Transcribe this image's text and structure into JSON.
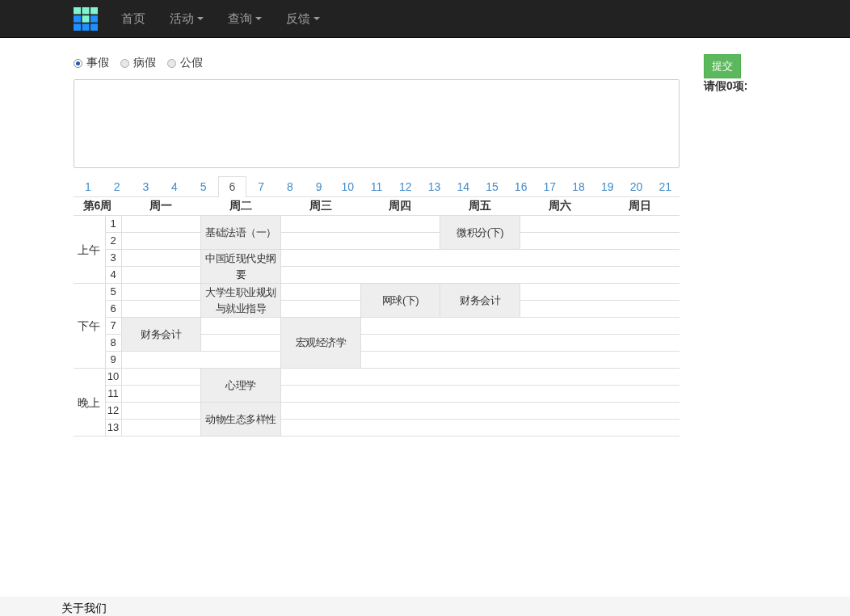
{
  "navbar": {
    "items": [
      {
        "label": "首页",
        "dropdown": false
      },
      {
        "label": "活动",
        "dropdown": true
      },
      {
        "label": "查询",
        "dropdown": true
      },
      {
        "label": "反馈",
        "dropdown": true
      }
    ]
  },
  "leave_types": [
    {
      "label": "事假",
      "selected": true
    },
    {
      "label": "病假",
      "selected": false
    },
    {
      "label": "公假",
      "selected": false
    }
  ],
  "week_tabs": [
    {
      "label": "1",
      "selected": false
    },
    {
      "label": "2",
      "selected": false
    },
    {
      "label": "3",
      "selected": false
    },
    {
      "label": "4",
      "selected": false
    },
    {
      "label": "5",
      "selected": false
    },
    {
      "label": "6",
      "selected": true
    },
    {
      "label": "7",
      "selected": false
    },
    {
      "label": "8",
      "selected": false
    },
    {
      "label": "9",
      "selected": false
    },
    {
      "label": "10",
      "selected": false
    },
    {
      "label": "11",
      "selected": false
    },
    {
      "label": "12",
      "selected": false
    },
    {
      "label": "13",
      "selected": false
    },
    {
      "label": "14",
      "selected": false
    },
    {
      "label": "15",
      "selected": false
    },
    {
      "label": "16",
      "selected": false
    },
    {
      "label": "17",
      "selected": false
    },
    {
      "label": "18",
      "selected": false
    },
    {
      "label": "19",
      "selected": false
    },
    {
      "label": "20",
      "selected": false
    },
    {
      "label": "21",
      "selected": false
    }
  ],
  "timetable": {
    "week_label": "第6周",
    "sections": [
      {
        "label": "上午",
        "periods": [
          "1",
          "2",
          "3",
          "4"
        ]
      },
      {
        "label": "下午",
        "periods": [
          "5",
          "6",
          "7",
          "8",
          "9"
        ]
      },
      {
        "label": "晚上",
        "periods": [
          "10",
          "11",
          "12",
          "13"
        ]
      }
    ],
    "days": [
      {
        "label": "周一",
        "slots": [
          {
            "kind": "empty"
          },
          {
            "kind": "empty"
          },
          {
            "kind": "empty"
          },
          {
            "kind": "empty"
          },
          {
            "kind": "empty"
          },
          {
            "kind": "empty"
          },
          {
            "kind": "course",
            "name": "财务会计"
          },
          {
            "kind": "continued"
          },
          {
            "kind": "empty"
          },
          {
            "kind": "empty"
          },
          {
            "kind": "empty"
          },
          {
            "kind": "empty"
          },
          {
            "kind": "empty"
          }
        ]
      },
      {
        "label": "周二",
        "slots": [
          {
            "kind": "course",
            "name": "基础法语（一）"
          },
          {
            "kind": "continued"
          },
          {
            "kind": "course",
            "name": "中国近现代史纲要"
          },
          {
            "kind": "continued"
          },
          {
            "kind": "course",
            "name": "大学生职业规划与就业指导"
          },
          {
            "kind": "continued"
          },
          {
            "kind": "empty"
          },
          {
            "kind": "empty"
          },
          {
            "kind": "empty"
          },
          {
            "kind": "course",
            "name": "心理学"
          },
          {
            "kind": "continued"
          },
          {
            "kind": "course",
            "name": "动物生态多样性"
          },
          {
            "kind": "continued"
          }
        ]
      },
      {
        "label": "周三",
        "slots": [
          {
            "kind": "empty"
          },
          {
            "kind": "empty"
          },
          {
            "kind": "empty"
          },
          {
            "kind": "empty"
          },
          {
            "kind": "empty"
          },
          {
            "kind": "empty"
          },
          {
            "kind": "course",
            "name": "宏观经济学"
          },
          {
            "kind": "continued"
          },
          {
            "kind": "continued"
          },
          {
            "kind": "empty"
          },
          {
            "kind": "empty"
          },
          {
            "kind": "empty"
          },
          {
            "kind": "empty"
          }
        ]
      },
      {
        "label": "周四",
        "slots": [
          {
            "kind": "empty"
          },
          {
            "kind": "empty"
          },
          {
            "kind": "empty"
          },
          {
            "kind": "empty"
          },
          {
            "kind": "course",
            "name": "网球(下)"
          },
          {
            "kind": "continued"
          },
          {
            "kind": "empty"
          },
          {
            "kind": "empty"
          },
          {
            "kind": "empty"
          },
          {
            "kind": "empty"
          },
          {
            "kind": "empty"
          },
          {
            "kind": "empty"
          },
          {
            "kind": "empty"
          }
        ]
      },
      {
        "label": "周五",
        "slots": [
          {
            "kind": "course",
            "name": "微积分(下)"
          },
          {
            "kind": "continued"
          },
          {
            "kind": "empty"
          },
          {
            "kind": "empty"
          },
          {
            "kind": "course",
            "name": "财务会计"
          },
          {
            "kind": "continued"
          },
          {
            "kind": "empty"
          },
          {
            "kind": "empty"
          },
          {
            "kind": "empty"
          },
          {
            "kind": "empty"
          },
          {
            "kind": "empty"
          },
          {
            "kind": "empty"
          },
          {
            "kind": "empty"
          }
        ]
      },
      {
        "label": "周六",
        "slots": [
          {
            "kind": "empty"
          },
          {
            "kind": "empty"
          },
          {
            "kind": "empty"
          },
          {
            "kind": "empty"
          },
          {
            "kind": "empty"
          },
          {
            "kind": "empty"
          },
          {
            "kind": "empty"
          },
          {
            "kind": "empty"
          },
          {
            "kind": "empty"
          },
          {
            "kind": "empty"
          },
          {
            "kind": "empty"
          },
          {
            "kind": "empty"
          },
          {
            "kind": "empty"
          }
        ]
      },
      {
        "label": "周日",
        "slots": [
          {
            "kind": "empty"
          },
          {
            "kind": "empty"
          },
          {
            "kind": "empty"
          },
          {
            "kind": "empty"
          },
          {
            "kind": "empty"
          },
          {
            "kind": "empty"
          },
          {
            "kind": "empty"
          },
          {
            "kind": "empty"
          },
          {
            "kind": "empty"
          },
          {
            "kind": "empty"
          },
          {
            "kind": "empty"
          },
          {
            "kind": "empty"
          },
          {
            "kind": "empty"
          }
        ]
      }
    ]
  },
  "side": {
    "submit": "提交",
    "summary": "请假0项:"
  },
  "footer": {
    "link": "关于我们"
  }
}
